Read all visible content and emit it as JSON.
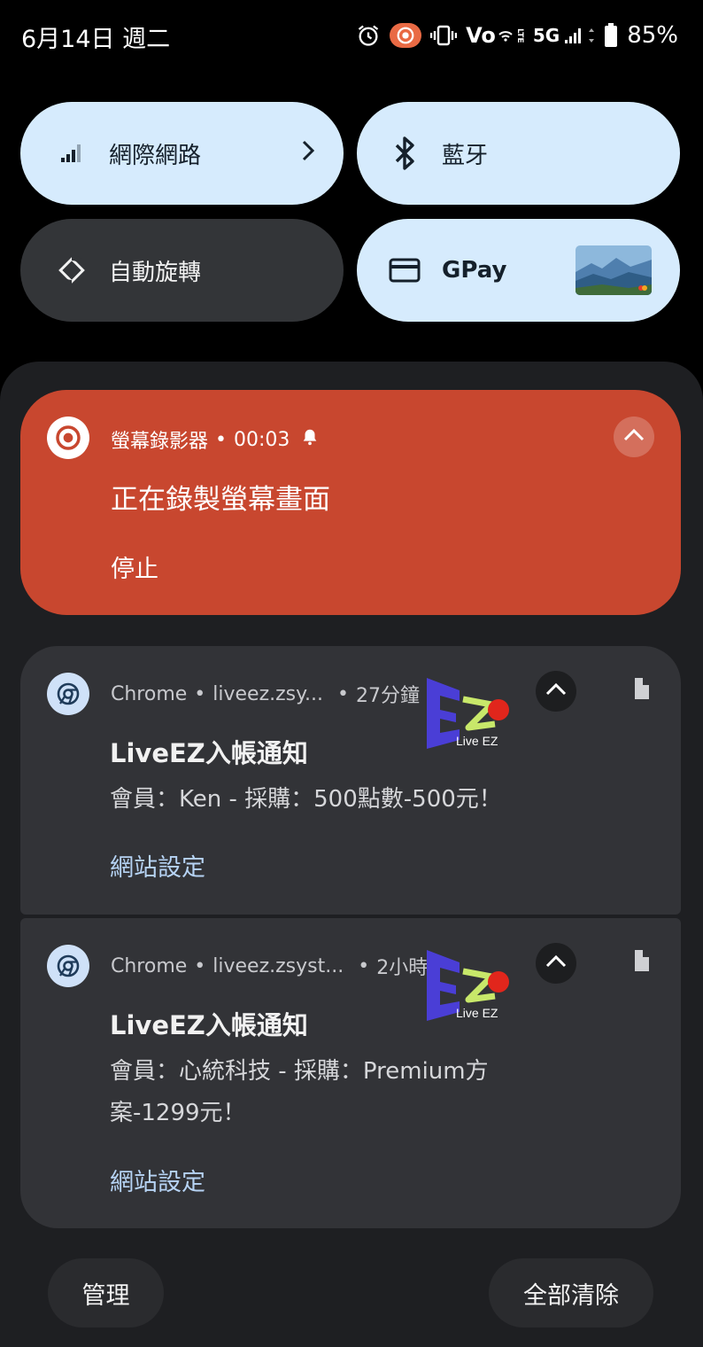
{
  "status_bar": {
    "date": "6月14日 週二",
    "network_label": "5G",
    "volte_label": "Vo",
    "lte_label": "LTE",
    "battery_percent": "85%",
    "icons": [
      "alarm-icon",
      "screen-record-icon",
      "vibrate-icon",
      "volte-icon",
      "5g-signal-icon",
      "battery-icon"
    ]
  },
  "quick_tiles": [
    {
      "label": "網際網路",
      "icon": "cellular-signal-icon",
      "state": "on",
      "has_chevron": true
    },
    {
      "label": "藍牙",
      "icon": "bluetooth-icon",
      "state": "on"
    },
    {
      "label": "自動旋轉",
      "icon": "auto-rotate-icon",
      "state": "off"
    },
    {
      "label": "GPay",
      "icon": "credit-card-icon",
      "state": "on"
    }
  ],
  "recorder_notification": {
    "app_name": "螢幕錄影器",
    "elapsed": "00:03",
    "title": "正在錄製螢幕畫面",
    "action": "停止",
    "color": "#c8472f"
  },
  "notifications": [
    {
      "app_name": "Chrome",
      "site": "liveez.zsy...",
      "time": "27分鐘",
      "title": "LiveEZ入帳通知",
      "text": "會員：Ken - 採購：500點數-500元！",
      "action": "網站設定",
      "logo_text": "Live EZ"
    },
    {
      "app_name": "Chrome",
      "site": "liveez.zsyst...",
      "time": "2小時",
      "title": "LiveEZ入帳通知",
      "text_line1": "會員：心統科技 - 採購：Premium方",
      "text_line2": "案-1299元！",
      "action": "網站設定",
      "logo_text": "Live EZ"
    }
  ],
  "footer": {
    "manage_label": "管理",
    "clear_all_label": "全部清除"
  },
  "colors": {
    "tile_on": "#d6ebfd",
    "tile_off": "#333538",
    "shade_bg": "#1e1f22",
    "card_bg": "#323337",
    "link_color": "#b6d3f4"
  }
}
